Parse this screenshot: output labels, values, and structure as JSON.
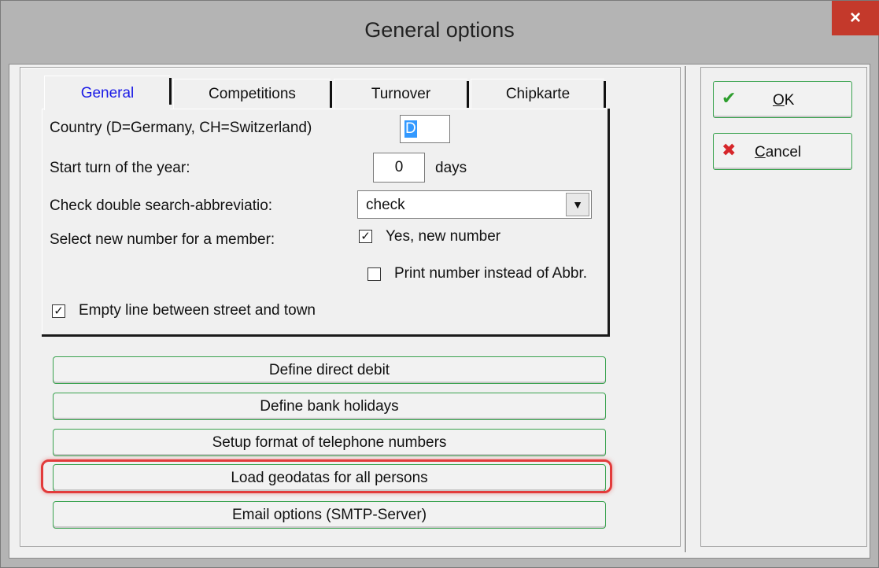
{
  "window": {
    "title": "General options",
    "close_glyph": "×"
  },
  "tabs": [
    {
      "label": "General",
      "active": true
    },
    {
      "label": "Competitions",
      "active": false
    },
    {
      "label": "Turnover",
      "active": false
    },
    {
      "label": "Chipkarte",
      "active": false
    }
  ],
  "general": {
    "country_label": "Country (D=Germany, CH=Switzerland)",
    "country_value": "D",
    "start_turn_label": "Start turn of the year:",
    "start_turn_value": "0",
    "start_turn_unit": "days",
    "check_double_label": "Check double search-abbreviatio:",
    "check_double_value": "check",
    "new_number_label": "Select new number for a member:",
    "yes_new_number_label": "Yes, new number",
    "yes_new_number_checked": true,
    "print_number_label": "Print number instead of Abbr.",
    "print_number_checked": false,
    "empty_line_label": "Empty line between street and town",
    "empty_line_checked": true
  },
  "actions": {
    "direct_debit": "Define direct debit",
    "bank_holidays": "Define bank holidays",
    "telephone_format": "Setup format of telephone numbers",
    "load_geodatas": "Load geodatas for all persons",
    "email_options": "Email options (SMTP-Server)"
  },
  "dialog_buttons": {
    "ok_mnemonic": "O",
    "ok_rest": "K",
    "cancel_mnemonic": "C",
    "cancel_rest": "ancel"
  },
  "icons": {
    "ok": "checkmark-icon",
    "cancel": "red-x-icon"
  },
  "colors": {
    "title_bg": "#b4b4b4",
    "close_bg": "#c4392b",
    "button_border": "#3aa34f",
    "active_tab": "#1a1ae6",
    "highlight": "#e23b3b"
  }
}
